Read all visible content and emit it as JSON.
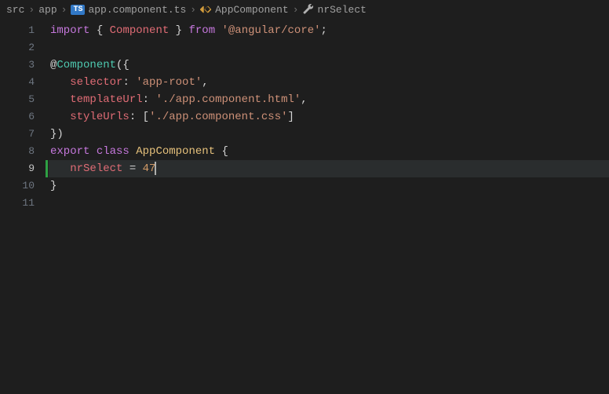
{
  "breadcrumb": {
    "items": [
      "src",
      "app",
      "app.component.ts",
      "AppComponent",
      "nrSelect"
    ],
    "fileBadge": "TS"
  },
  "lineNumbers": [
    "1",
    "2",
    "3",
    "4",
    "5",
    "6",
    "7",
    "8",
    "9",
    "10",
    "11"
  ],
  "activeLine": 9,
  "code": {
    "l1": {
      "t1": "import",
      "t2": "{",
      "t3": "Component",
      "t4": "}",
      "t5": "from",
      "t6": "'@angular/core'",
      "t7": ";"
    },
    "l2": "",
    "l3": {
      "t1": "@",
      "t2": "Component",
      "t3": "({"
    },
    "l4": {
      "t1": "selector",
      "t2": ":",
      "t3": "'app-root'",
      "t4": ","
    },
    "l5": {
      "t1": "templateUrl",
      "t2": ":",
      "t3": "'./app.component.html'",
      "t4": ","
    },
    "l6": {
      "t1": "styleUrls",
      "t2": ":",
      "t3": "[",
      "t4": "'./app.component.css'",
      "t5": "]"
    },
    "l7": {
      "t1": "})"
    },
    "l8": {
      "t1": "export",
      "t2": "class",
      "t3": "AppComponent",
      "t4": "{"
    },
    "l9": {
      "t1": "nrSelect",
      "t2": "=",
      "t3": "47"
    },
    "l10": {
      "t1": "}"
    },
    "l11": ""
  }
}
